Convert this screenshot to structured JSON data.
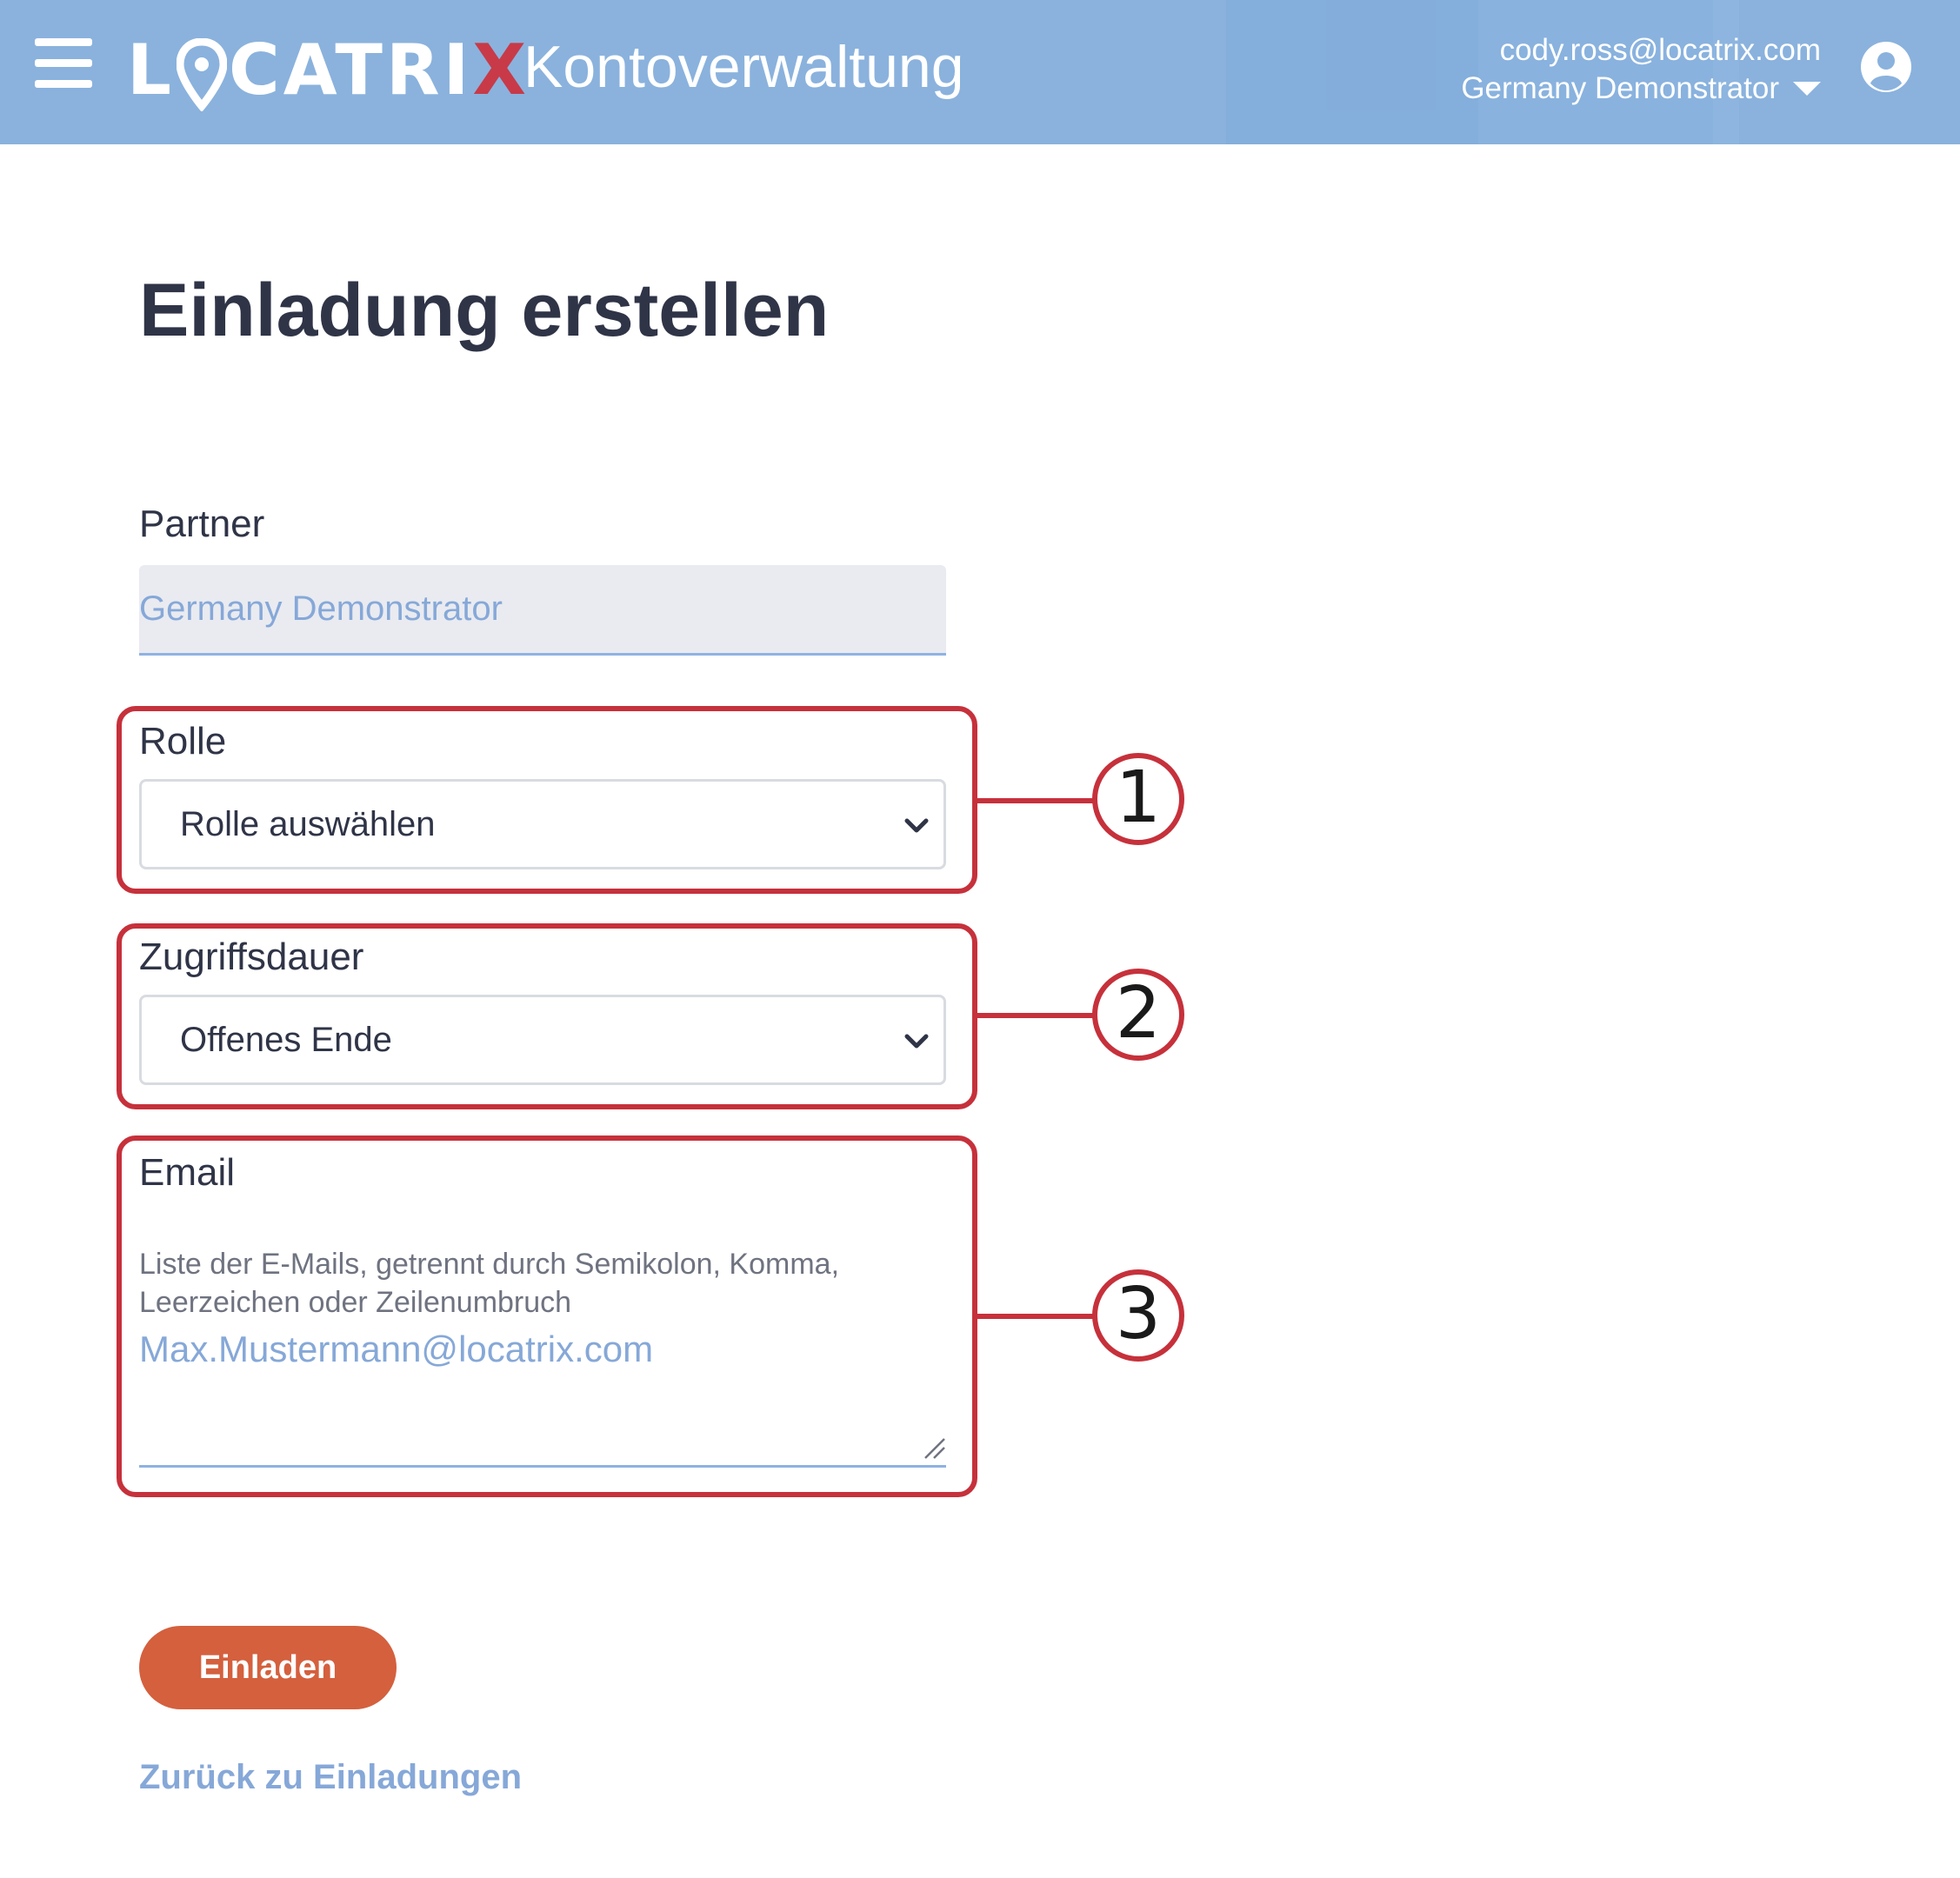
{
  "header": {
    "logo_text_left": "L",
    "logo_text_right": "CATRI",
    "logo_text_x": "X",
    "app_name": "Kontoverwaltung",
    "user_email": "cody.ross@locatrix.com",
    "user_org": "Germany Demonstrator"
  },
  "page": {
    "title": "Einladung erstellen"
  },
  "form": {
    "partner_label": "Partner",
    "partner_value": "Germany Demonstrator",
    "role_label": "Rolle",
    "role_selected": "Rolle auswählen",
    "duration_label": "Zugriffsdauer",
    "duration_selected": "Offenes Ende",
    "email_label": "Email",
    "email_hint": "Liste der E-Mails, getrennt durch Semikolon, Komma, Leerzeichen oder Zeilenumbruch",
    "email_value": "Max.Mustermann@locatrix.com"
  },
  "annotations": [
    "1",
    "2",
    "3"
  ],
  "actions": {
    "invite_label": "Einladen",
    "back_link": "Zurück zu Einladungen"
  },
  "colors": {
    "header_bg": "#8ab2dd",
    "accent_red": "#c6313b",
    "button_orange": "#d4603e",
    "link_blue": "#86a8d8"
  }
}
